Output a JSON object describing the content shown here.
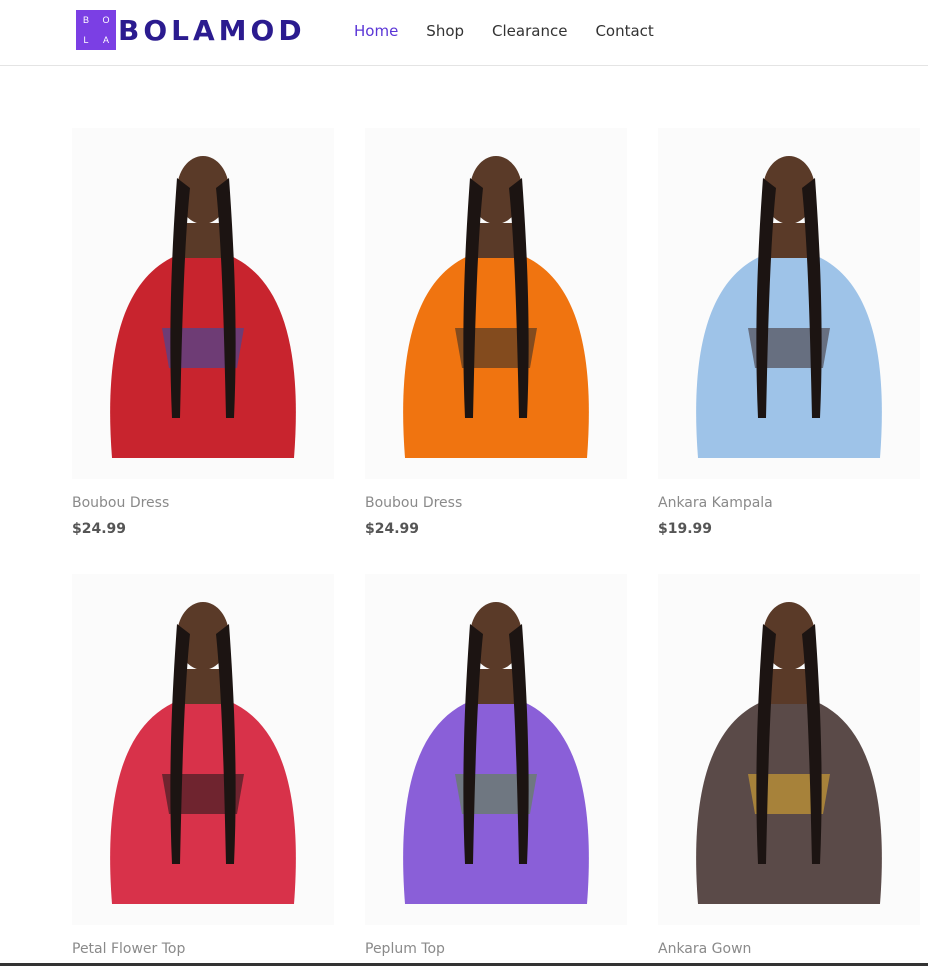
{
  "brand": {
    "logo_letters": [
      "B",
      "O",
      "L",
      "A"
    ],
    "name": "BOLAMOD",
    "accent": "#7b3fe4"
  },
  "nav": {
    "items": [
      {
        "label": "Home"
      },
      {
        "label": "Shop"
      },
      {
        "label": "Clearance"
      },
      {
        "label": "Contact"
      }
    ]
  },
  "products": [
    {
      "name": "Boubou Dress",
      "price": "$24.99",
      "dress_color": "#c8242e",
      "accent_color": "#2450b0"
    },
    {
      "name": "Boubou Dress",
      "price": "$24.99",
      "dress_color": "#f07410",
      "accent_color": "#2a2a2a"
    },
    {
      "name": "Ankara Kampala",
      "price": "$19.99",
      "dress_color": "#9ec3e8",
      "accent_color": "#3a2a2a"
    },
    {
      "name": "Petal Flower Top",
      "price": "",
      "dress_color": "#d8324a",
      "accent_color": "#1a1a1a"
    },
    {
      "name": "Peplum Top",
      "price": "",
      "dress_color": "#8a5fd8",
      "accent_color": "#5a8a3a"
    },
    {
      "name": "Ankara Gown",
      "price": "",
      "dress_color": "#5a4a48",
      "accent_color": "#e8b030"
    }
  ]
}
